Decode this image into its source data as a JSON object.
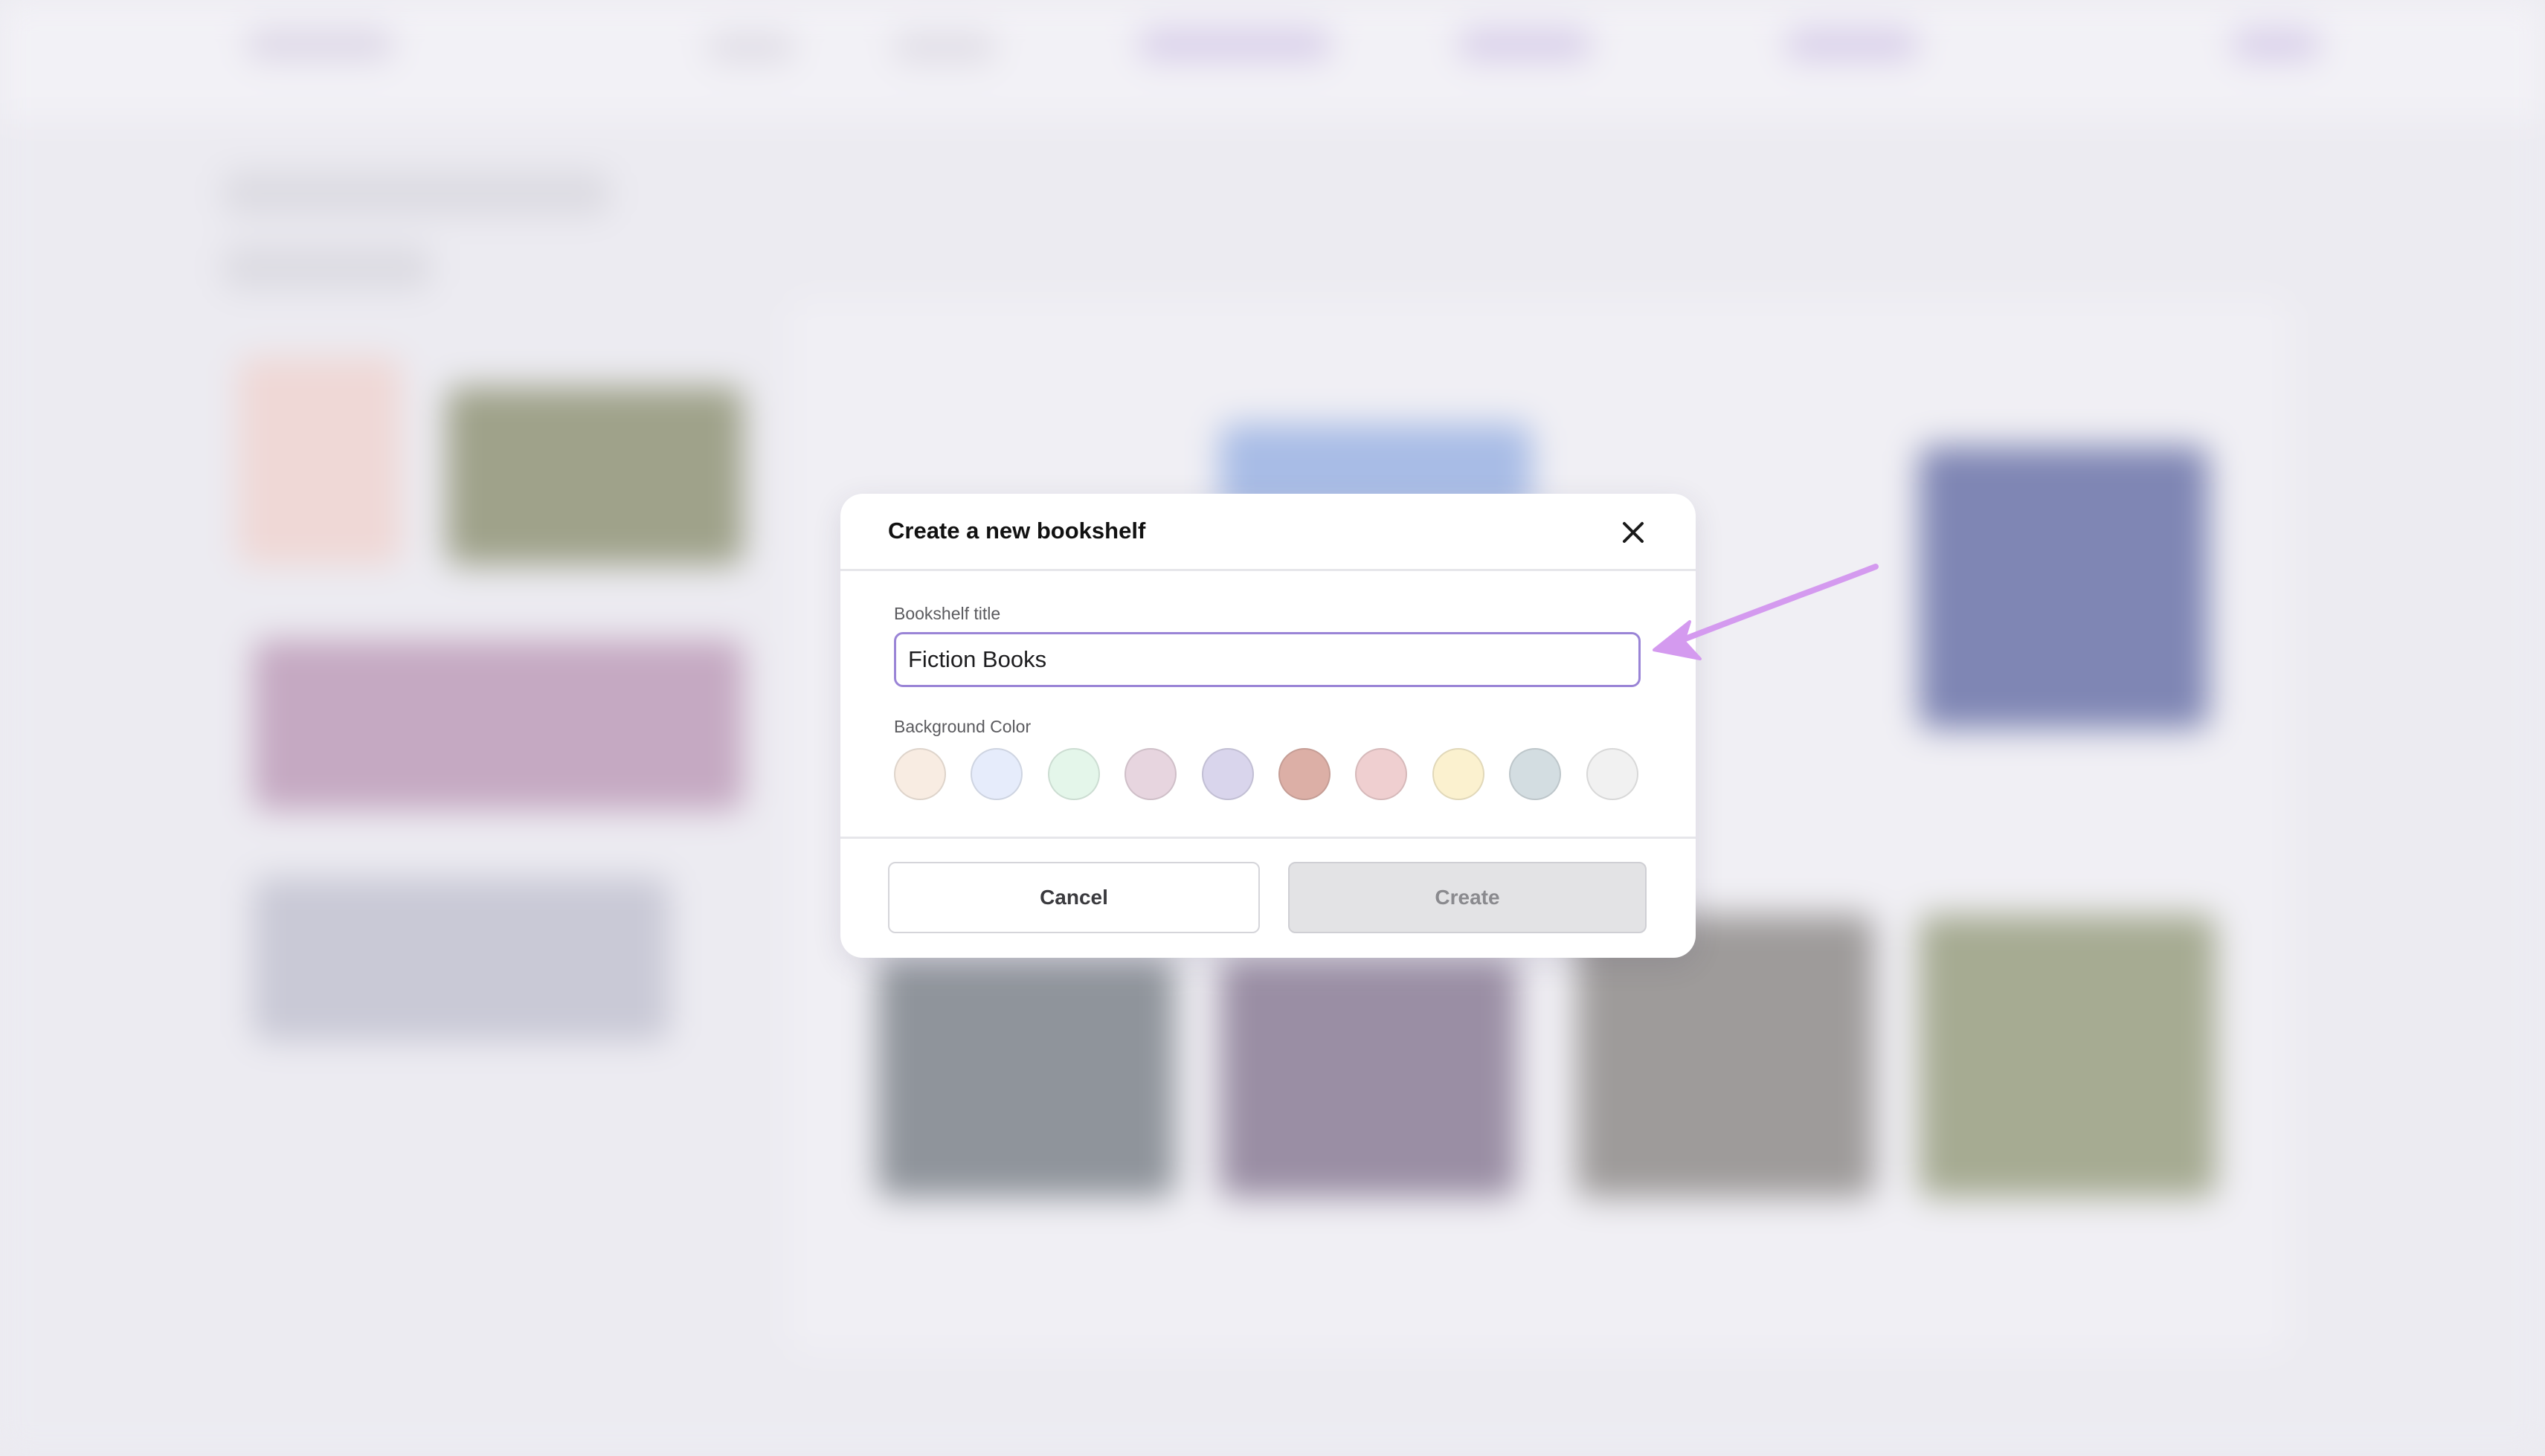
{
  "dialog": {
    "title": "Create a new bookshelf",
    "close_icon": "close-icon",
    "title_field": {
      "label": "Bookshelf title",
      "value": "Fiction Books"
    },
    "color_field": {
      "label": "Background Color",
      "swatches": [
        "#f8ece2",
        "#e6ecfb",
        "#e4f6ea",
        "#e7d5df",
        "#d9d5ec",
        "#dcafa6",
        "#efcfd0",
        "#fbf1cf",
        "#d3dde1",
        "#f1f1f1"
      ]
    },
    "cancel_label": "Cancel",
    "create_label": "Create"
  },
  "annotation": {
    "arrow_color": "#d49aef",
    "arrow_icon": "arrow-pointer-icon"
  }
}
